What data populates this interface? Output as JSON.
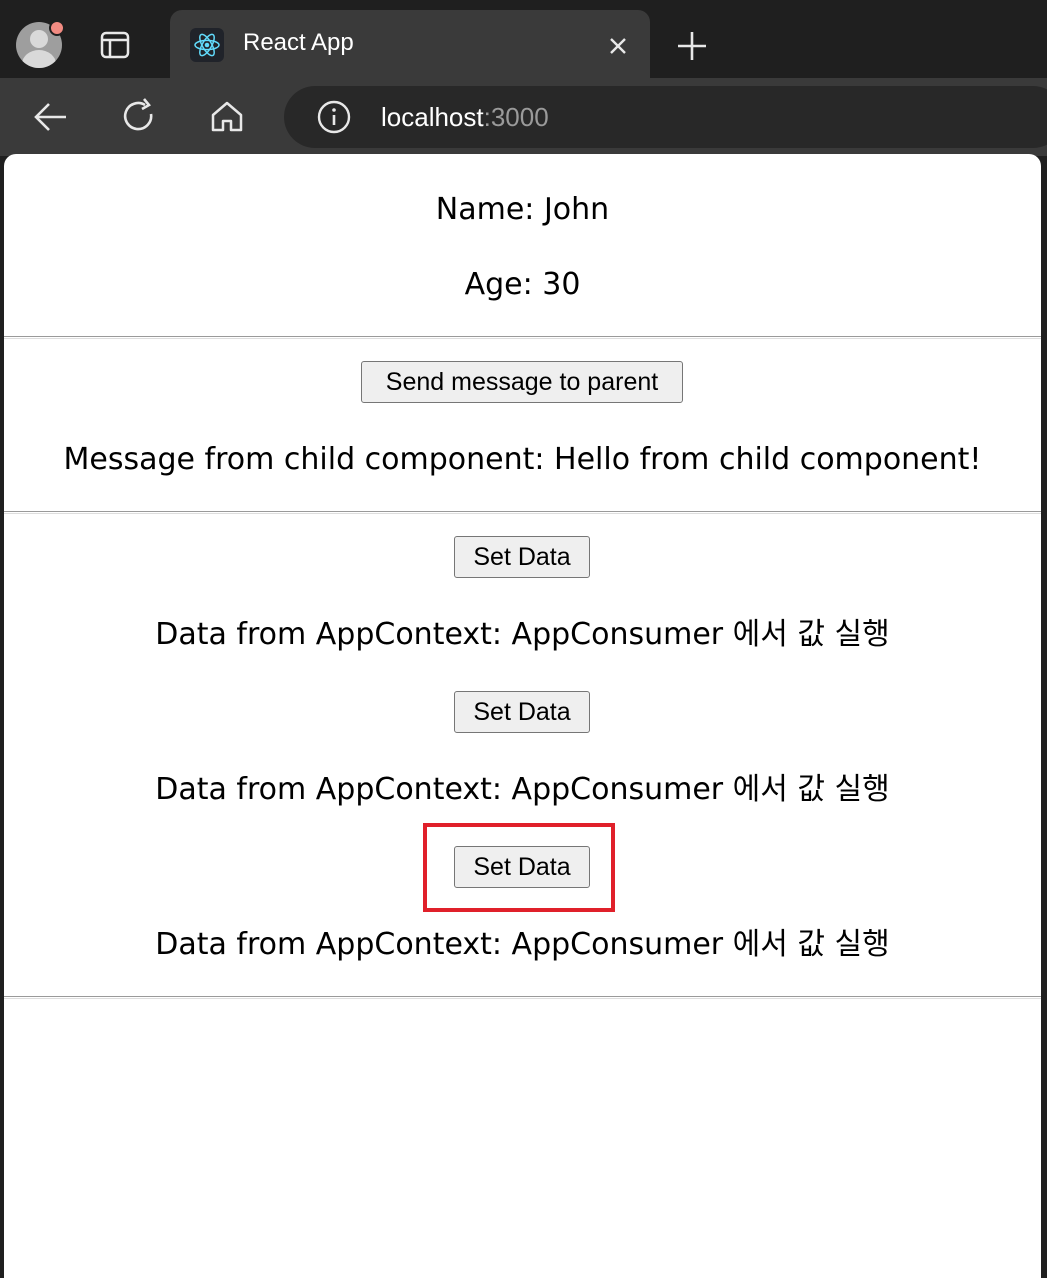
{
  "browser": {
    "tab_title": "React App",
    "url_host": "localhost",
    "url_port": ":3000"
  },
  "page": {
    "name_line": "Name: John",
    "age_line": "Age: 30",
    "send_button": "Send message to parent",
    "message_line": "Message from child component: Hello from child component!",
    "context_blocks": [
      {
        "button": "Set Data",
        "text": "Data from AppContext: AppConsumer 에서 값 실행"
      },
      {
        "button": "Set Data",
        "text": "Data from AppContext: AppConsumer 에서 값 실행"
      },
      {
        "button": "Set Data",
        "text": "Data from AppContext: AppConsumer 에서 값 실행"
      }
    ]
  },
  "colors": {
    "highlight": "#e0202a",
    "react_logo": "#61dafb"
  }
}
